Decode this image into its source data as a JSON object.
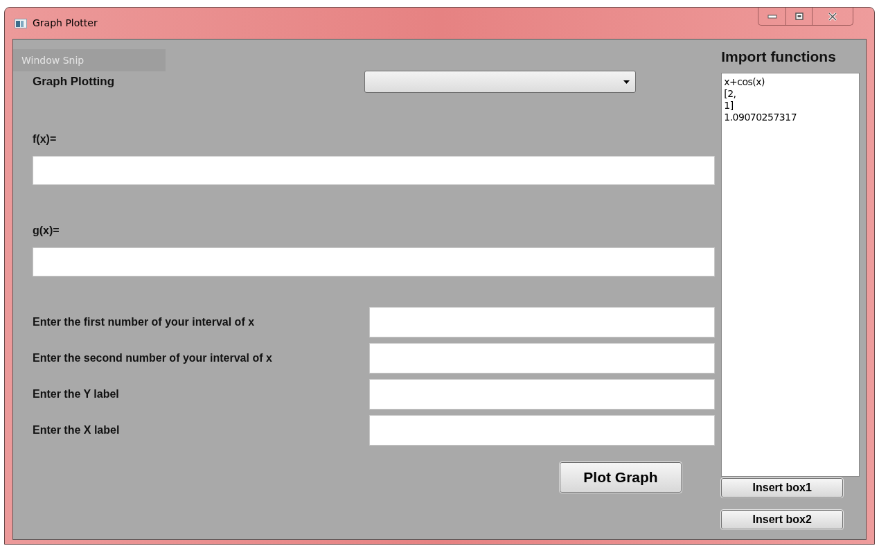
{
  "window": {
    "title": "Graph Plotter"
  },
  "overlay_label": "Window Snip",
  "heading": "Graph Plotting",
  "functions": [
    {
      "label": "f(x)="
    },
    {
      "label": "g(x)="
    }
  ],
  "settings": [
    {
      "label": "Enter the first number of your interval of x"
    },
    {
      "label": "Enter the second number of your interval of x"
    },
    {
      "label": "Enter the Y label"
    },
    {
      "label": "Enter the X label"
    }
  ],
  "plot_button": "Plot Graph",
  "import_panel": {
    "title": "Import functions",
    "lines": [
      "x+cos(x)",
      "[2,",
      "1]",
      "1.09070257317"
    ],
    "buttons": [
      "Insert box1",
      "Insert box2"
    ]
  }
}
